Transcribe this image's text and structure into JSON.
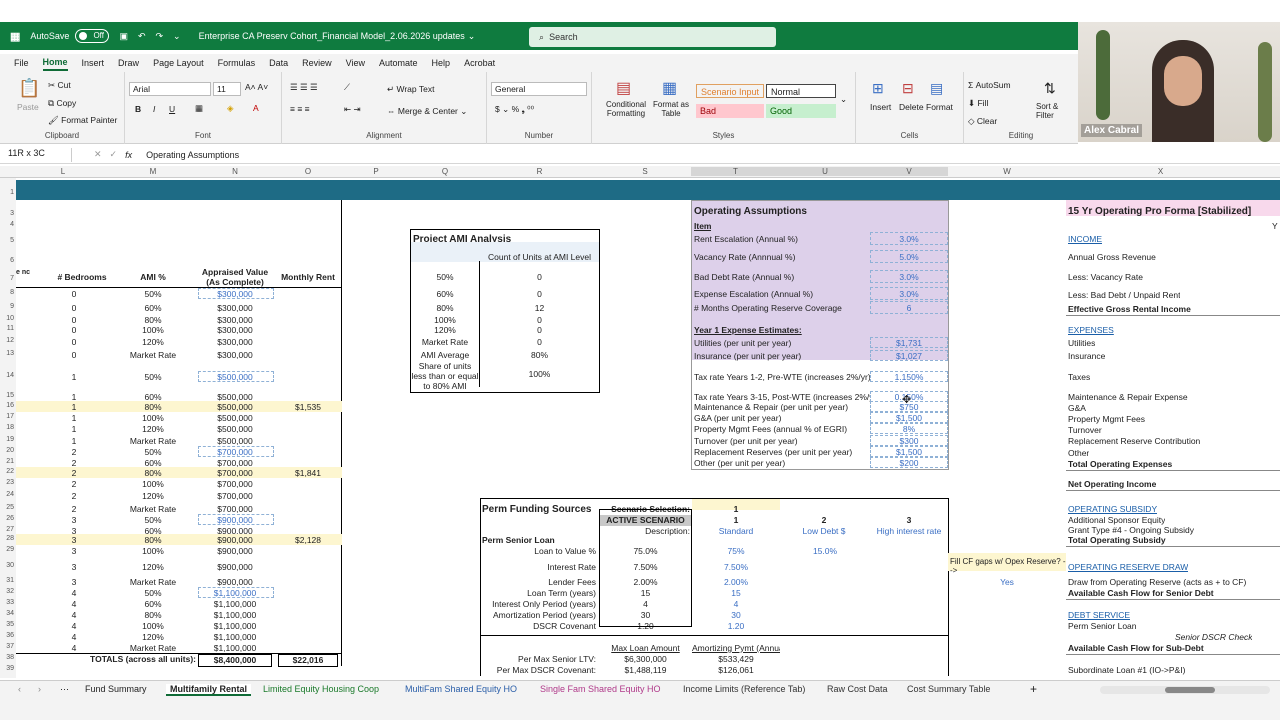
{
  "titlebar": {
    "autosave_label": "AutoSave",
    "autosave_state": "Off",
    "filename": "Enterprise CA Preserv Cohort_Financial Model_2.06.2026 updates",
    "search_placeholder": "Search"
  },
  "menu": [
    "File",
    "Home",
    "Insert",
    "Draw",
    "Page Layout",
    "Formulas",
    "Data",
    "Review",
    "View",
    "Automate",
    "Help",
    "Acrobat"
  ],
  "ribbon": {
    "clipboard": {
      "paste": "Paste",
      "cut": "Cut",
      "copy": "Copy",
      "format_painter": "Format Painter",
      "label": "Clipboard"
    },
    "font": {
      "name": "Arial",
      "size": "11",
      "label": "Font"
    },
    "alignment": {
      "wrap": "Wrap Text",
      "merge": "Merge & Center",
      "label": "Alignment"
    },
    "number": {
      "format": "General",
      "label": "Number"
    },
    "styles": {
      "cond": "Conditional Formatting",
      "table": "Format as Table",
      "scenario": "Scenario Input",
      "normal": "Normal",
      "bad": "Bad",
      "good": "Good",
      "label": "Styles"
    },
    "cells": {
      "insert": "Insert",
      "delete": "Delete",
      "format": "Format",
      "label": "Cells"
    },
    "editing": {
      "autosum": "AutoSum",
      "fill": "Fill",
      "clear": "Clear",
      "sort": "Sort & Filter",
      "label": "Editing"
    }
  },
  "webcam": {
    "name": "Alex Cabral"
  },
  "formula": {
    "namebox": "11R x 3C",
    "fx": "fx",
    "content": "Operating Assumptions"
  },
  "columns": [
    "L",
    "M",
    "N",
    "O",
    "P",
    "Q",
    "R",
    "S",
    "T",
    "U",
    "V",
    "W",
    "X"
  ],
  "rows": [
    "1",
    "3",
    "4",
    "5",
    "6",
    "7",
    "8",
    "9",
    "10",
    "11",
    "12",
    "13",
    "14",
    "15",
    "16",
    "17",
    "18",
    "19",
    "20",
    "21",
    "22",
    "23",
    "24",
    "25",
    "26",
    "27",
    "28",
    "29",
    "30",
    "31",
    "32",
    "33",
    "34",
    "35",
    "36",
    "37",
    "38",
    "39"
  ],
  "units_table": {
    "headers": {
      "bedrooms": "# Bedrooms",
      "ami": "AMI %",
      "appraised": "Appraised Value (As Complete)",
      "rent": "Monthly Rent",
      "clip": "e nce]"
    },
    "rows": [
      [
        "0",
        "50%",
        "$300,000",
        ""
      ],
      [
        "0",
        "60%",
        "$300,000",
        ""
      ],
      [
        "0",
        "80%",
        "$300,000",
        ""
      ],
      [
        "0",
        "100%",
        "$300,000",
        ""
      ],
      [
        "0",
        "120%",
        "$300,000",
        ""
      ],
      [
        "0",
        "Market Rate",
        "$300,000",
        ""
      ],
      [
        "1",
        "50%",
        "$500,000",
        ""
      ],
      [
        "1",
        "60%",
        "$500,000",
        ""
      ],
      [
        "1",
        "80%",
        "$500,000",
        "$1,535"
      ],
      [
        "1",
        "100%",
        "$500,000",
        ""
      ],
      [
        "1",
        "120%",
        "$500,000",
        ""
      ],
      [
        "1",
        "Market Rate",
        "$500,000",
        ""
      ],
      [
        "2",
        "50%",
        "$700,000",
        ""
      ],
      [
        "2",
        "60%",
        "$700,000",
        ""
      ],
      [
        "2",
        "80%",
        "$700,000",
        "$1,841"
      ],
      [
        "2",
        "100%",
        "$700,000",
        ""
      ],
      [
        "2",
        "120%",
        "$700,000",
        ""
      ],
      [
        "2",
        "Market Rate",
        "$700,000",
        ""
      ],
      [
        "3",
        "50%",
        "$900,000",
        ""
      ],
      [
        "3",
        "60%",
        "$900,000",
        ""
      ],
      [
        "3",
        "80%",
        "$900,000",
        "$2,128"
      ],
      [
        "3",
        "100%",
        "$900,000",
        ""
      ],
      [
        "3",
        "120%",
        "$900,000",
        ""
      ],
      [
        "3",
        "Market Rate",
        "$900,000",
        ""
      ],
      [
        "4",
        "50%",
        "$1,100,000",
        ""
      ],
      [
        "4",
        "60%",
        "$1,100,000",
        ""
      ],
      [
        "4",
        "80%",
        "$1,100,000",
        ""
      ],
      [
        "4",
        "100%",
        "$1,100,000",
        ""
      ],
      [
        "4",
        "120%",
        "$1,100,000",
        ""
      ],
      [
        "4",
        "Market Rate",
        "$1,100,000",
        ""
      ]
    ],
    "total_label": "TOTALS (across all units):",
    "total_value": "$8,400,000",
    "total_rent": "$22,016"
  },
  "ami_analysis": {
    "title": "Project AMI Analysis",
    "header": "Count of Units at AMI Level",
    "rows": [
      [
        "50%",
        "0"
      ],
      [
        "60%",
        "0"
      ],
      [
        "80%",
        "12"
      ],
      [
        "100%",
        "0"
      ],
      [
        "120%",
        "0"
      ],
      [
        "Market Rate",
        "0"
      ],
      [
        "AMI Average",
        "80%"
      ],
      [
        "Share of units less than or equal to 80% AMI",
        "100%"
      ]
    ]
  },
  "operating": {
    "title": "Operating Assumptions",
    "item": "Item",
    "rows": [
      [
        "Rent Escalation (Annual %)",
        "3.0%"
      ],
      [
        "Vacancy Rate (Annnual %)",
        "5.0%"
      ],
      [
        "Bad Debt Rate (Annual %)",
        "3.0%"
      ],
      [
        "Expense Escalation (Annual %)",
        "3.0%"
      ],
      [
        "# Months Operating Reserve Coverage",
        "6"
      ]
    ],
    "year1": "Year 1 Expense Estimates:",
    "exp": [
      [
        "Utilities (per unit per year)",
        "$1,731"
      ],
      [
        "Insurance (per unit per year)",
        "$1,027"
      ],
      [
        "Tax rate Years 1-2, Pre-WTE (increases 2%/yr)",
        "1.150%"
      ],
      [
        "Tax rate Years 3-15, Post-WTE (increases 2%/yr)",
        "0.150%"
      ],
      [
        "Maintenance & Repair (per unit per year)",
        "$750"
      ],
      [
        "G&A (per unit per year)",
        "$1,500"
      ],
      [
        "Property Mgmt Fees (annual % of EGRI)",
        "8%"
      ],
      [
        "Turnover (per unit per year)",
        "$300"
      ],
      [
        "Replacement Reserves (per unit per year)",
        "$1,500"
      ],
      [
        "Other (per unit per year)",
        "$200"
      ]
    ]
  },
  "perm": {
    "title": "Perm Funding Sources",
    "scenario_label": "Scenario Selection:",
    "scenario_value": "1",
    "active": "ACTIVE SCENARIO",
    "desc_label": "Description:",
    "scenarios": [
      "1",
      "2",
      "3"
    ],
    "desc": [
      "Standard",
      "Low Debt $",
      "High interest rate"
    ],
    "senior": "Perm Senior Loan",
    "rows": [
      [
        "Loan to Value %",
        "75.0%",
        "75%",
        "15.0%"
      ],
      [
        "Interest Rate",
        "7.50%",
        "7.50%",
        ""
      ],
      [
        "Lender Fees",
        "2.00%",
        "2.00%",
        ""
      ],
      [
        "Loan Term (years)",
        "15",
        "15",
        ""
      ],
      [
        "Interest Only Period (years)",
        "4",
        "4",
        ""
      ],
      [
        "Amortization Period (years)",
        "30",
        "30",
        ""
      ],
      [
        "DSCR Covenant",
        "1.20",
        "1.20",
        ""
      ]
    ],
    "max_amount": "Max Loan Amount",
    "amort_pymt": "Amortizing Pymt (Annual)",
    "ltv_label": "Per Max Senior LTV:",
    "ltv_amt": "$6,300,000",
    "ltv_pymt": "$533,429",
    "dscr_label": "Per Max DSCR Covenant:",
    "dscr_amt": "$1,488,119",
    "dscr_pymt": "$126,061"
  },
  "fill_gap": {
    "q": "Fill CF gaps w/ Opex Reserve? -->",
    "a": "Yes"
  },
  "proforma": {
    "title": "15 Yr Operating Pro Forma [Stabilized]",
    "year": "Y",
    "lines": [
      [
        "INCOME",
        "link"
      ],
      [
        "Annual Gross Revenue",
        ""
      ],
      [
        "Less: Vacancy Rate",
        ""
      ],
      [
        "Less: Bad Debt / Unpaid Rent",
        ""
      ],
      [
        "Effective Gross Rental Income",
        "bold"
      ],
      [
        "EXPENSES",
        "link"
      ],
      [
        "Utilities",
        ""
      ],
      [
        "Insurance",
        ""
      ],
      [
        "Taxes",
        ""
      ],
      [
        "Maintenance & Repair Expense",
        ""
      ],
      [
        "G&A",
        ""
      ],
      [
        "Property Mgmt Fees",
        ""
      ],
      [
        "Turnover",
        ""
      ],
      [
        "Replacement Reserve Contribution",
        ""
      ],
      [
        "Other",
        ""
      ],
      [
        "Total Operating Expenses",
        "bold"
      ],
      [
        "Net Operating Income",
        "bold"
      ],
      [
        "OPERATING SUBSIDY",
        "link"
      ],
      [
        "Additional Sponsor Equity",
        ""
      ],
      [
        "Grant Type #4 - Ongoing Subsidy",
        ""
      ],
      [
        "Total Operating Subsidy",
        "bold"
      ],
      [
        "OPERATING RESERVE DRAW",
        "link"
      ],
      [
        "Draw from Operating Reserve (acts as + to CF)",
        ""
      ],
      [
        "Available Cash Flow for Senior Debt",
        "bold"
      ],
      [
        "DEBT SERVICE",
        "link"
      ],
      [
        "Perm Senior Loan",
        ""
      ],
      [
        "Senior DSCR Check",
        "ital"
      ],
      [
        "Available Cash Flow for Sub-Debt",
        "bold"
      ],
      [
        "Subordinate Loan #1 (IO->P&I)",
        ""
      ]
    ]
  },
  "tabs": [
    "Fund Summary",
    "Multifamily Rental",
    "Limited Equity Housing Coop",
    "MultiFam Shared Equity HO",
    "Single Fam Shared Equity HO",
    "Income Limits (Reference Tab)",
    "Raw Cost Data",
    "Cost Summary Table"
  ],
  "colors": {
    "excel_green": "#0f7b3f",
    "band": "#1e6b85",
    "good": "#c6efce",
    "bad": "#ffc7ce"
  }
}
